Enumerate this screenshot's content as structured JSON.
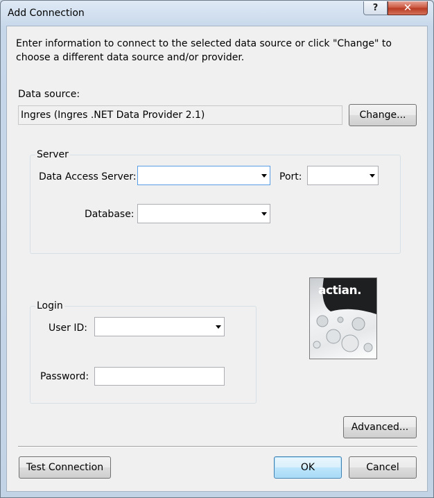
{
  "window": {
    "title": "Add Connection",
    "help_glyph": "?",
    "close_glyph": "✕"
  },
  "intro": "Enter information to connect to the selected data source or click \"Change\" to choose a different data source and/or provider.",
  "data_source": {
    "label": "Data source:",
    "value": "Ingres (Ingres .NET Data Provider 2.1)",
    "change_button": "Change..."
  },
  "server_group": {
    "title": "Server",
    "data_access_server_label": "Data Access Server:",
    "data_access_server_value": "",
    "port_label": "Port:",
    "port_value": "",
    "database_label": "Database:",
    "database_value": ""
  },
  "login_group": {
    "title": "Login",
    "user_id_label": "User ID:",
    "user_id_value": "",
    "password_label": "Password:",
    "password_value": ""
  },
  "logo": {
    "text": "actian.",
    "icon": "actian-logo"
  },
  "buttons": {
    "advanced": "Advanced...",
    "test_connection": "Test Connection",
    "ok": "OK",
    "cancel": "Cancel"
  },
  "colors": {
    "default_button_border": "#3c7fb1",
    "close_button": "#c9533c",
    "window_frame": "#c6d7ea"
  }
}
